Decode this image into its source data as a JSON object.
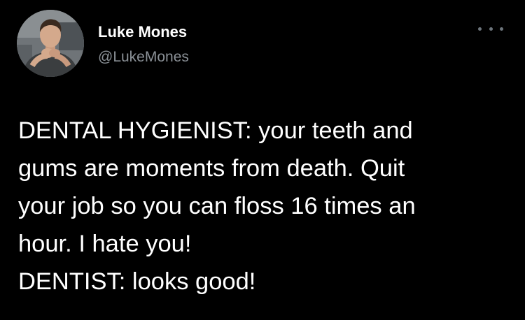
{
  "author": {
    "name": "Luke Mones",
    "handle": "@LukeMones",
    "avatar_icon": "profile-photo"
  },
  "menu": {
    "icon": "more-options-icon"
  },
  "tweet": {
    "lines": [
      "DENTAL HYGIENIST: your teeth and",
      "gums are moments from death. Quit",
      "your job so you can floss 16 times an",
      "hour. I hate you!",
      "DENTIST: looks good!"
    ]
  },
  "colors": {
    "background": "#000000",
    "name": "#ffffff",
    "handle": "#8b9197",
    "text": "#ffffff"
  }
}
